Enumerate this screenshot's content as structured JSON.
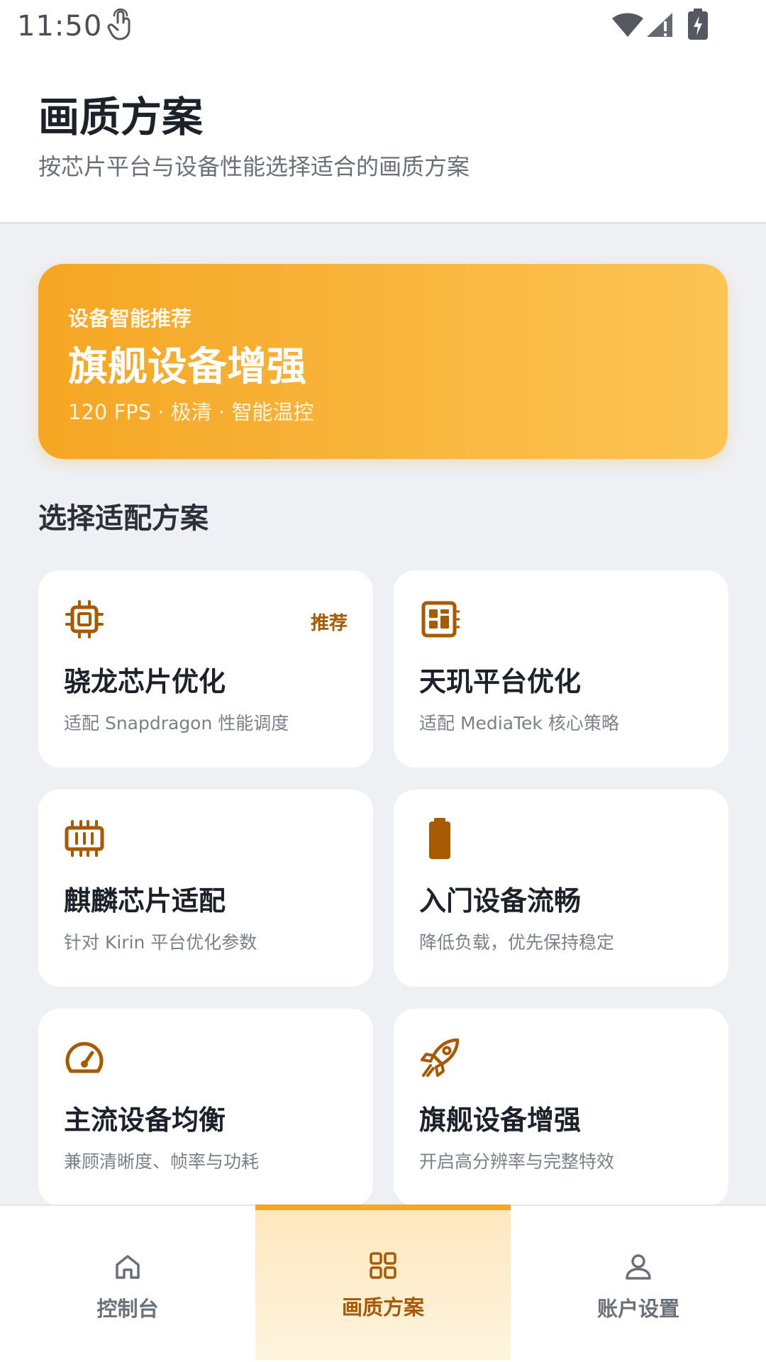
{
  "status_bar": {
    "time": "11:50",
    "icons": [
      "touch-icon",
      "wifi-icon",
      "signal-icon",
      "battery-charging-icon"
    ]
  },
  "header": {
    "title": "画质方案",
    "subtitle": "按芯片平台与设备性能选择适合的画质方案"
  },
  "hero": {
    "tag": "设备智能推荐",
    "title": "旗舰设备增强",
    "description": "120 FPS · 极清 · 智能温控"
  },
  "section": {
    "title": "选择适配方案"
  },
  "cards": [
    {
      "icon": "chip-icon",
      "title": "骁龙芯片优化",
      "desc": "适配 Snapdragon 性能调度",
      "badge": "推荐"
    },
    {
      "icon": "dashboard-chip-icon",
      "title": "天玑平台优化",
      "desc": "适配 MediaTek 核心策略"
    },
    {
      "icon": "memory-icon",
      "title": "麒麟芯片适配",
      "desc": "针对 Kirin 平台优化参数"
    },
    {
      "icon": "battery-icon",
      "title": "入门设备流畅",
      "desc": "降低负载，优先保持稳定"
    },
    {
      "icon": "speedometer-icon",
      "title": "主流设备均衡",
      "desc": "兼顾清晰度、帧率与功耗"
    },
    {
      "icon": "rocket-icon",
      "title": "旗舰设备增强",
      "desc": "开启高分辨率与完整特效"
    }
  ],
  "bottom_nav": [
    {
      "label": "控制台",
      "icon": "home-icon",
      "active": false
    },
    {
      "label": "画质方案",
      "icon": "grid-icon",
      "active": true
    },
    {
      "label": "账户设置",
      "icon": "user-icon",
      "active": false
    }
  ],
  "colors": {
    "accent": "#f5a623",
    "accent_dark": "#a85a00",
    "background": "#eef0f4"
  }
}
